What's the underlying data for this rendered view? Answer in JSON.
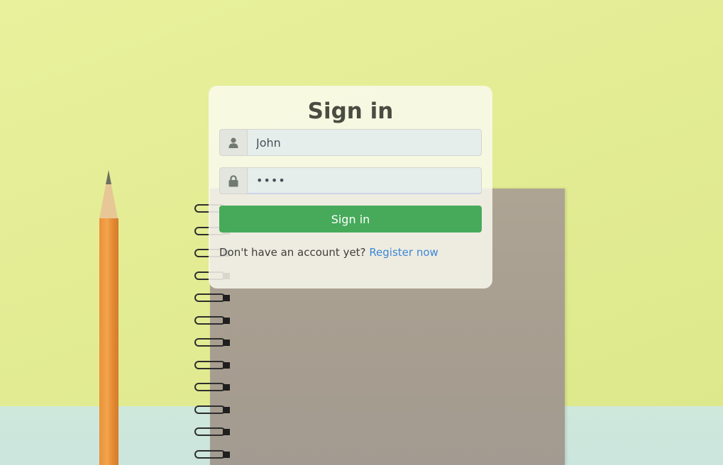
{
  "login": {
    "title": "Sign in",
    "username_value": "John",
    "password_value": "••••",
    "submit_label": "Sign in",
    "register_prompt": "Don't have an account yet?",
    "register_link": "Register now"
  },
  "icons": {
    "username": "user-icon",
    "password": "lock-icon"
  },
  "colors": {
    "accent_green": "#46aa5a",
    "link_blue": "#3d87d6",
    "background_yellow": "#e4ed95"
  }
}
